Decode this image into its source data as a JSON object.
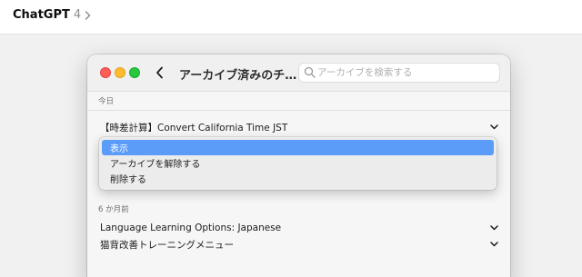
{
  "app": {
    "name": "ChatGPT",
    "version": "4"
  },
  "window": {
    "title": "アーカイブ済みのチ…",
    "search": {
      "placeholder": "アーカイブを検索する",
      "value": ""
    }
  },
  "sections": [
    {
      "label": "今日",
      "items": [
        {
          "title": "【時差計算】Convert California Time JST"
        }
      ]
    },
    {
      "label": "6 か月前",
      "items": [
        {
          "title": "Language Learning Options: Japanese"
        },
        {
          "title": "猫背改善トレーニングメニュー"
        }
      ]
    }
  ],
  "context_menu": {
    "items": [
      {
        "label": "表示",
        "active": true
      },
      {
        "label": "アーカイブを解除する",
        "active": false
      },
      {
        "label": "削除する",
        "active": false
      }
    ]
  },
  "colors": {
    "highlight": "#5a9cf8",
    "traffic_red": "#ff5f57",
    "traffic_yellow": "#febc2e",
    "traffic_green": "#28c840"
  }
}
